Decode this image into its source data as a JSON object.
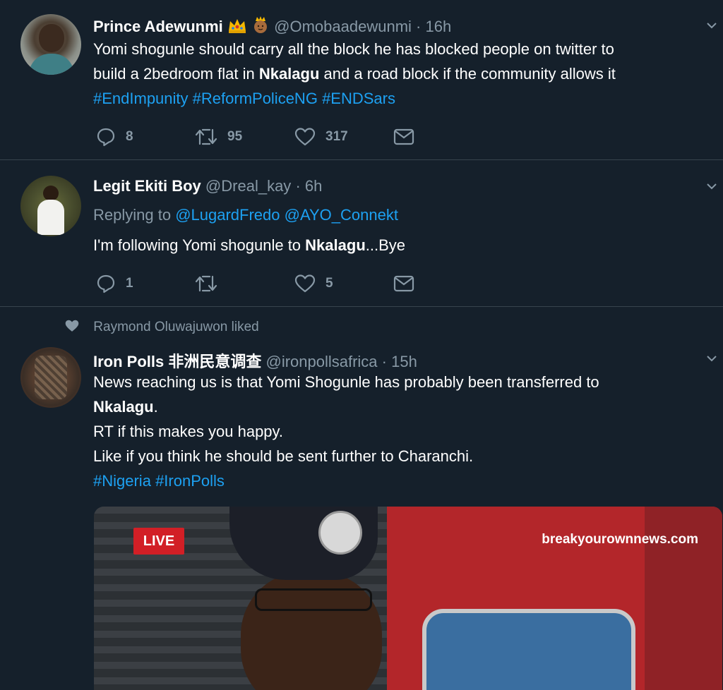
{
  "tweets": [
    {
      "name": "Prince Adewunmi",
      "handle": "@Omobaadewunmi",
      "time": "· 16h",
      "text_1": "Yomi shogunle should carry all the block he has blocked people on twitter to",
      "text_2a": "build a 2bedroom flat in ",
      "text_2b": "Nkalagu",
      "text_2c": " and a road block if the community allows it",
      "hashtags": [
        "#EndImpunity",
        "#ReformPoliceNG",
        "#ENDSars"
      ],
      "replies": "8",
      "retweets": "95",
      "likes": "317",
      "icons": [
        "crown-emoji-icon",
        "prince-emoji-icon"
      ]
    },
    {
      "name": "Legit Ekiti Boy",
      "handle": "@Dreal_kay",
      "time": "· 6h",
      "replying_prefix": "Replying to ",
      "replying_to": [
        "@LugardFredo",
        "@AYO_Connekt"
      ],
      "text_a": "I'm following Yomi shogunle to ",
      "text_b": "Nkalagu",
      "text_c": "...Bye",
      "replies": "1",
      "retweets": "",
      "likes": "5"
    },
    {
      "social_context": "Raymond Oluwajuwon liked",
      "name": "Iron Polls 非洲民意调查",
      "handle": "@ironpollsafrica",
      "time": "· 15h",
      "line1": "News reaching us is that Yomi Shogunle has probably been transferred to",
      "line2": "Nkalagu",
      "line2_end": ".",
      "line3": "RT if this makes you happy.",
      "line4": "Like if you think he should be sent further to Charanchi.",
      "hashtags": [
        "#Nigeria",
        "#IronPolls"
      ],
      "media": {
        "live_label": "LIVE",
        "watermark": "breakyourownnews.com"
      }
    }
  ],
  "colors": {
    "background": "#15202b",
    "divider": "#38444d",
    "muted": "#8899a6",
    "link": "#1da1f2"
  }
}
